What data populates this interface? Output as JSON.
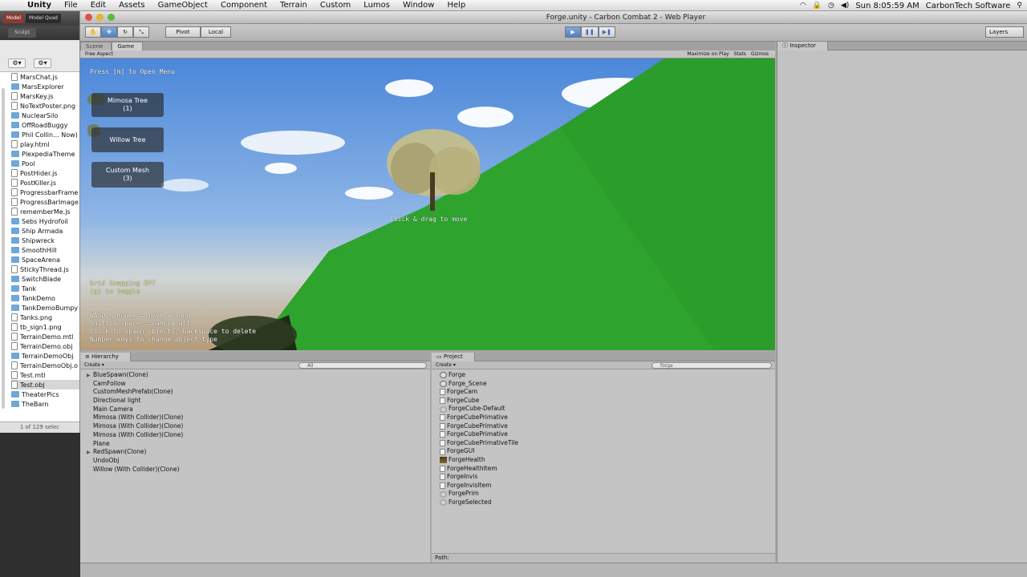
{
  "menubar": {
    "app": "Unity",
    "items": [
      "File",
      "Edit",
      "Assets",
      "GameObject",
      "Component",
      "Terrain",
      "Custom",
      "Lumos",
      "Window",
      "Help"
    ],
    "clock": "Sun 8:05:59 AM",
    "user": "CarbonTech Software"
  },
  "finder": {
    "tab_model": "Model",
    "tab_model_quad": "Model Quad",
    "tab_sculpt": "Sculpt",
    "items": [
      {
        "name": "MarsChat.js",
        "kind": "doc"
      },
      {
        "name": "MarsExplorer",
        "kind": "folder"
      },
      {
        "name": "MarsKey.js",
        "kind": "doc"
      },
      {
        "name": "NoTextPoster.png",
        "kind": "doc"
      },
      {
        "name": "NuclearSilo",
        "kind": "folder"
      },
      {
        "name": "OffRoadBuggy",
        "kind": "folder"
      },
      {
        "name": "Phil Collin... Now)",
        "kind": "folder"
      },
      {
        "name": "play.html",
        "kind": "doc"
      },
      {
        "name": "PlexpediaTheme",
        "kind": "folder"
      },
      {
        "name": "Pool",
        "kind": "folder"
      },
      {
        "name": "PostHider.js",
        "kind": "doc"
      },
      {
        "name": "PostKiller.js",
        "kind": "doc"
      },
      {
        "name": "ProgressbarFrame",
        "kind": "doc"
      },
      {
        "name": "ProgressBarImage",
        "kind": "doc"
      },
      {
        "name": "rememberMe.js",
        "kind": "doc"
      },
      {
        "name": "Sebs Hydrofoil",
        "kind": "folder"
      },
      {
        "name": "Ship Armada",
        "kind": "folder"
      },
      {
        "name": "Shipwreck",
        "kind": "folder"
      },
      {
        "name": "SmoothHill",
        "kind": "folder"
      },
      {
        "name": "SpaceArena",
        "kind": "folder"
      },
      {
        "name": "StickyThread.js",
        "kind": "doc"
      },
      {
        "name": "SwitchBlade",
        "kind": "folder"
      },
      {
        "name": "Tank",
        "kind": "folder"
      },
      {
        "name": "TankDemo",
        "kind": "folder"
      },
      {
        "name": "TankDemoBumpy",
        "kind": "folder"
      },
      {
        "name": "Tanks.png",
        "kind": "doc"
      },
      {
        "name": "tb_sign1.png",
        "kind": "doc"
      },
      {
        "name": "TerrainDemo.mtl",
        "kind": "doc"
      },
      {
        "name": "TerrainDemo.obj",
        "kind": "doc"
      },
      {
        "name": "TerrainDemoObj",
        "kind": "folder"
      },
      {
        "name": "TerrainDemoObj.o",
        "kind": "doc"
      },
      {
        "name": "Test.mtl",
        "kind": "doc"
      },
      {
        "name": "Test.obj",
        "kind": "doc",
        "selected": true
      },
      {
        "name": "TheaterPics",
        "kind": "folder"
      },
      {
        "name": "TheBarn",
        "kind": "folder"
      }
    ],
    "status": "1 of 129 selec"
  },
  "window": {
    "title": "Forge.unity - Carbon Combat 2 - Web Player"
  },
  "toolbar": {
    "pivot": "Pivot",
    "local": "Local",
    "play_icon": "play-icon",
    "pause_icon": "pause-icon",
    "step_icon": "step-icon",
    "layers": "Layers"
  },
  "game": {
    "tab_scene": "Scene",
    "tab_game": "Game",
    "aspect": "Free Aspect",
    "maximize": "Maximize on Play",
    "stats": "Stats",
    "gizmos": "Gizmos",
    "menu_hint": "Press [m] to Open Menu",
    "btn_mimosa_1": "Mimosa Tree",
    "btn_mimosa_2": "(1)",
    "btn_willow": "Willow Tree",
    "btn_custom_1": "Custom Mesh",
    "btn_custom_2": "(3)",
    "drag_hint": "Click & drag to move",
    "grid_1": "Grid Snapping OFF",
    "grid_2": "(g) to toggle",
    "help_1": "WASD & mouse = move around",
    "help_2": "Shift & space = camera alt",
    "help_3": "Click to spawn objects; backspace to delete",
    "help_4": "Number keys to change object type"
  },
  "hierarchy": {
    "title": "Hierarchy",
    "create": "Create",
    "search": "All",
    "items": [
      {
        "name": "BlueSpawn(Clone)",
        "arrow": true
      },
      {
        "name": "CamFollow",
        "arrow": false
      },
      {
        "name": "CustomMeshPrefab(Clone)",
        "arrow": false
      },
      {
        "name": "Directional light",
        "arrow": false
      },
      {
        "name": "Main Camera",
        "arrow": false
      },
      {
        "name": "Mimosa (With Collider)(Clone)",
        "arrow": false
      },
      {
        "name": "Mimosa (With Collider)(Clone)",
        "arrow": false
      },
      {
        "name": "Mimosa (With Collider)(Clone)",
        "arrow": false
      },
      {
        "name": "Plane",
        "arrow": false
      },
      {
        "name": "RedSpawn(Clone)",
        "arrow": true
      },
      {
        "name": "UndoObj",
        "arrow": false
      },
      {
        "name": "Willow (With Collider)(Clone)",
        "arrow": false
      }
    ]
  },
  "project": {
    "title": "Project",
    "create": "Create",
    "search": "forge",
    "path_label": "Path:",
    "items": [
      {
        "name": "Forge",
        "icon": "scene"
      },
      {
        "name": "Forge_Scene",
        "icon": "scene"
      },
      {
        "name": "ForgeCam",
        "icon": "doc"
      },
      {
        "name": "ForgeCube",
        "icon": "doc"
      },
      {
        "name": "ForgeCube-Default",
        "icon": "ball"
      },
      {
        "name": "ForgeCubePrimative",
        "icon": "doc"
      },
      {
        "name": "ForgeCubePrimative",
        "icon": "doc"
      },
      {
        "name": "ForgeCubePrimative",
        "icon": "doc"
      },
      {
        "name": "ForgeCubePrimativeTile",
        "icon": "doc"
      },
      {
        "name": "ForgeGUI",
        "icon": "doc"
      },
      {
        "name": "ForgeHealth",
        "icon": "tex"
      },
      {
        "name": "ForgeHealthItem",
        "icon": "doc"
      },
      {
        "name": "ForgeInvis",
        "icon": "doc"
      },
      {
        "name": "ForgeInvisItem",
        "icon": "doc"
      },
      {
        "name": "ForgePrim",
        "icon": "ball"
      },
      {
        "name": "ForgeSelected",
        "icon": "ball"
      }
    ]
  },
  "inspector": {
    "title": "Inspector"
  },
  "colors": {
    "hill": "#2ea32e",
    "sky": "#4b87d9",
    "play_active": "#4f7fc4"
  }
}
